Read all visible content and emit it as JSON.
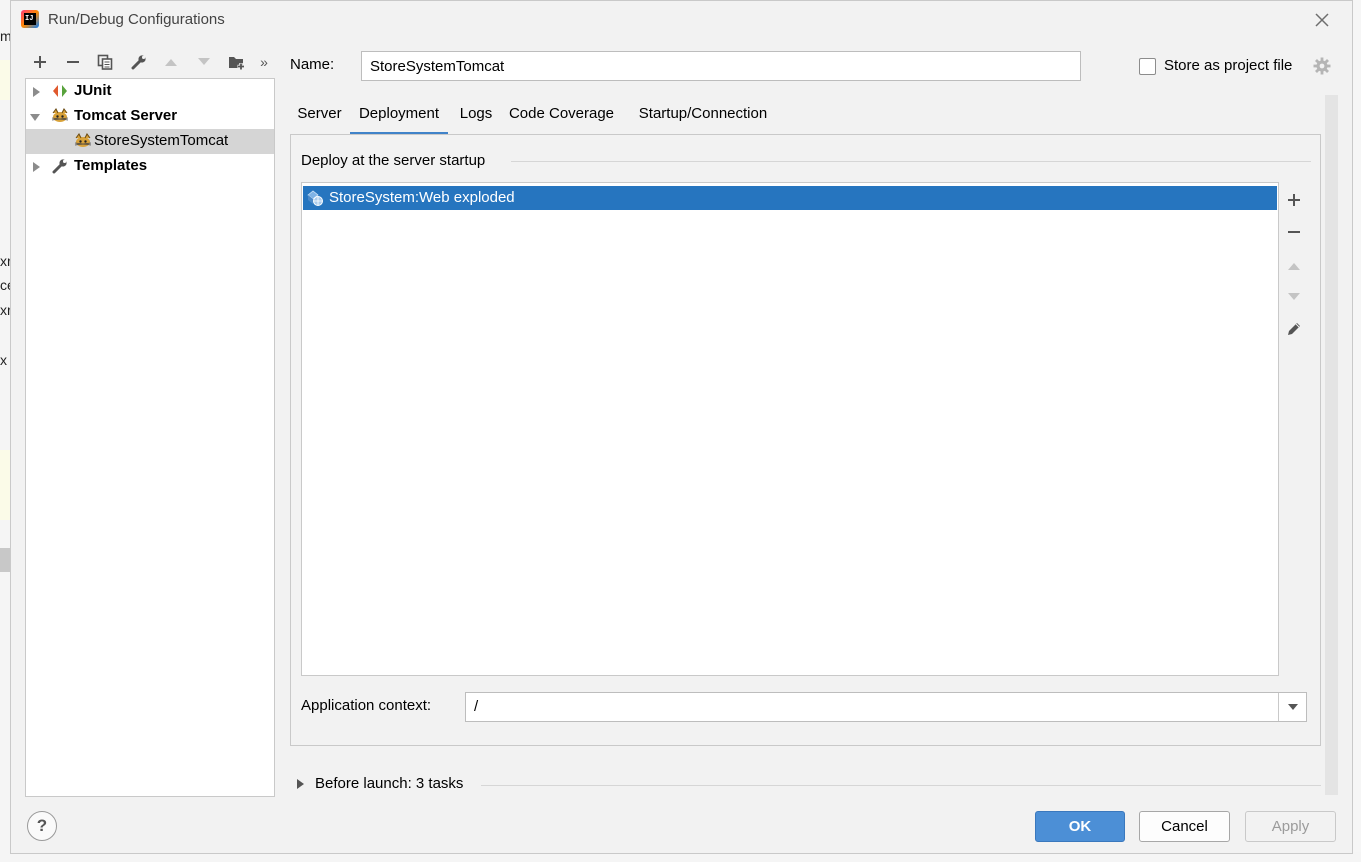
{
  "window": {
    "title": "Run/Debug Configurations"
  },
  "toolbar": {
    "buttons": [
      "add-icon",
      "remove-icon",
      "copy-icon",
      "wrench-icon",
      "move-up-icon",
      "move-down-icon",
      "new-folder-icon",
      "more-icon"
    ],
    "more_label": "»"
  },
  "tree": {
    "items": [
      {
        "label": "JUnit",
        "icon": "junit-icon",
        "expanded": false,
        "bold": true
      },
      {
        "label": "Tomcat Server",
        "icon": "tomcat-icon",
        "expanded": true,
        "bold": true
      },
      {
        "label": "StoreSystemTomcat",
        "icon": "tomcat-icon",
        "selected": true,
        "bold": false
      },
      {
        "label": "Templates",
        "icon": "wrench-icon",
        "expanded": false,
        "bold": true
      }
    ]
  },
  "name_field": {
    "label": "Name:",
    "value": "StoreSystemTomcat"
  },
  "store_as_project": {
    "label": "Store as project file",
    "checked": false
  },
  "tabs": [
    {
      "label": "Server",
      "active": false
    },
    {
      "label": "Deployment",
      "active": true
    },
    {
      "label": "Logs",
      "active": false
    },
    {
      "label": "Code Coverage",
      "active": false
    },
    {
      "label": "Startup/Connection",
      "active": false
    }
  ],
  "deployment": {
    "section_title": "Deploy at the server startup",
    "artifacts": [
      {
        "label": "StoreSystem:Web exploded",
        "selected": true
      }
    ],
    "side_buttons": [
      "add-icon",
      "remove-icon",
      "move-up-icon",
      "move-down-icon",
      "edit-icon"
    ],
    "context_label": "Application context:",
    "context_value": "/"
  },
  "before_launch": {
    "label": "Before launch: 3 tasks",
    "expanded": false
  },
  "buttons": {
    "help": "?",
    "ok": "OK",
    "cancel": "Cancel",
    "apply": "Apply"
  },
  "colors": {
    "selection": "#2675bf",
    "ok_button": "#4c8fd6",
    "tab_underline": "#4083c9"
  },
  "background_fragments": [
    "m",
    "xr",
    "ce",
    "xr",
    "x"
  ]
}
